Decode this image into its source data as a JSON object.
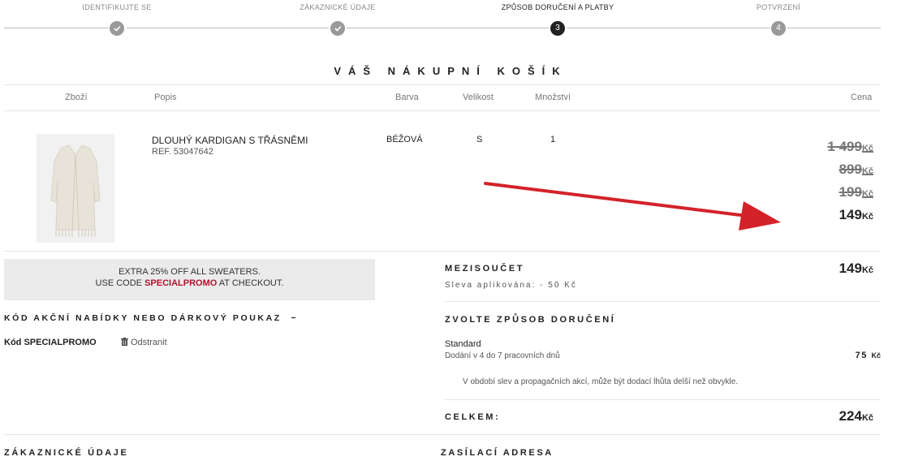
{
  "steps": [
    {
      "label": "IDENTIFIKUJTE SE",
      "state": "done",
      "number": ""
    },
    {
      "label": "ZÁKAZNICKÉ ÚDAJE",
      "state": "done",
      "number": ""
    },
    {
      "label": "ZPŮSOB DORUČENÍ A PLATBY",
      "state": "active",
      "number": "3"
    },
    {
      "label": "POTVRZENÍ",
      "state": "pending",
      "number": "4"
    }
  ],
  "cart": {
    "title": "VÁŠ NÁKUPNÍ KOŠÍK",
    "columns": {
      "item": "Zboží",
      "description": "Popis",
      "color": "Barva",
      "size": "Velikost",
      "qty": "Množství",
      "price": "Cena"
    },
    "item": {
      "name": "DLOUHÝ KARDIGAN S TŘÁSNĚMI",
      "ref": "REF. 53047642",
      "color": "BÉŽOVÁ",
      "size": "S",
      "qty": "1",
      "prices": [
        {
          "amount": "1 499",
          "currency": "Kč",
          "struck": true
        },
        {
          "amount": "899",
          "currency": "Kč",
          "struck": true
        },
        {
          "amount": "199",
          "currency": "Kč",
          "struck": true
        },
        {
          "amount": "149",
          "currency": "Kč",
          "struck": false
        }
      ]
    }
  },
  "promo_banner": {
    "line1": "EXTRA 25% OFF ALL SWEATERS.",
    "line2_prefix": "USE CODE",
    "line2_code": "SPECIALPROMO",
    "line2_suffix": "AT CHECKOUT."
  },
  "voucher": {
    "heading": "KÓD AKČNÍ NABÍDKY NEBO DÁRKOVÝ POUKAZ",
    "toggle": "−",
    "applied_code": "Kód SPECIALPROMO",
    "remove_label": "Odstranit"
  },
  "summary": {
    "subtotal_label": "MEZISOUČET",
    "discount_label": "Sleva aplikována: - 50 Kč",
    "subtotal_amount": "149",
    "subtotal_currency": "Kč",
    "shipping_heading": "ZVOLTE ZPŮSOB DORUČENÍ",
    "shipping_method": "Standard",
    "shipping_detail": "Dodání v 4 do 7 pracovních dnů",
    "shipping_price": "75",
    "shipping_currency": "Kč",
    "shipping_note": "V období slev a propagačních akcí, může být dodací lhůta delší než obvykle.",
    "total_label": "CELKEM:",
    "total_amount": "224",
    "total_currency": "Kč"
  },
  "sections": {
    "customer": "ZÁKAZNICKÉ ÚDAJE",
    "shipping_address": "ZASÍLACÍ ADRESA"
  },
  "colors": {
    "accent": "#b0122d",
    "arrow": "#d3222a"
  }
}
